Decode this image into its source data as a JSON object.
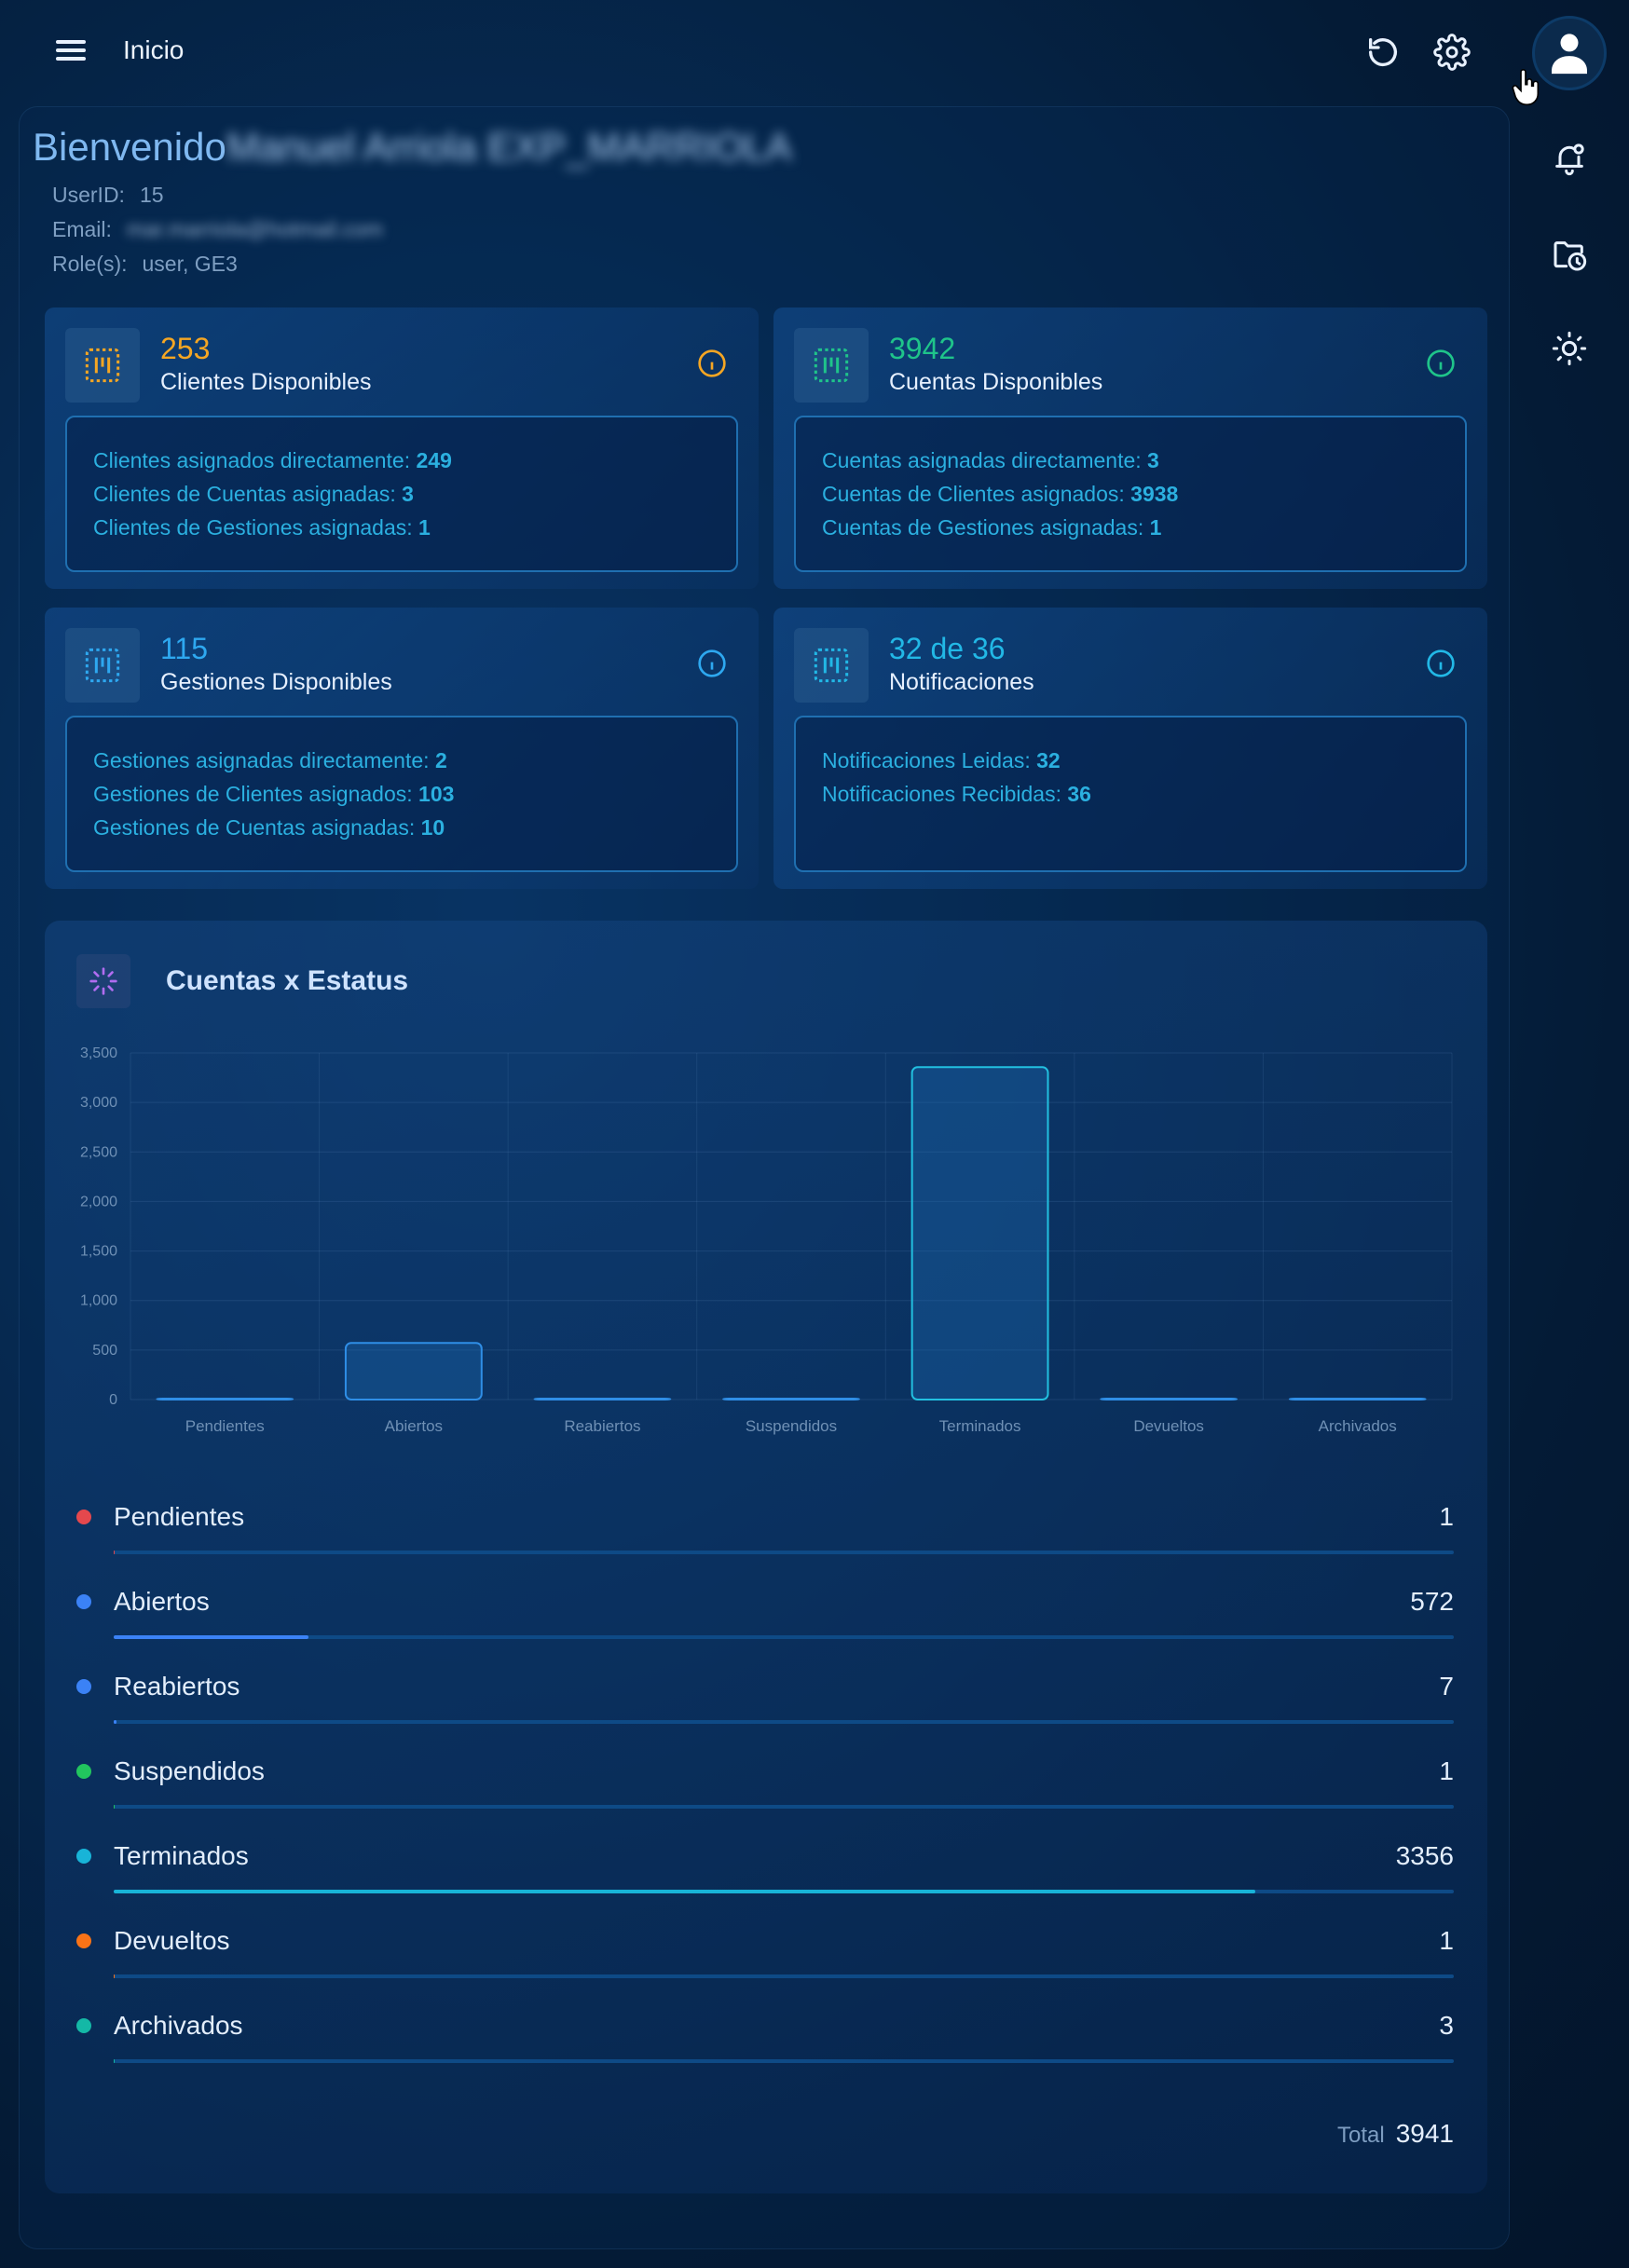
{
  "header": {
    "title": "Inicio",
    "icons": [
      "menu-icon",
      "refresh-icon",
      "gear-icon",
      "user-avatar-icon"
    ]
  },
  "rail": {
    "icons": [
      "bell-icon",
      "folder-clock-icon",
      "sun-icon"
    ]
  },
  "welcome": {
    "greeting": "Bienvenido",
    "name": "Manuel Arriola EXP_MARRIOLA",
    "user_id_label": "UserID:",
    "user_id": "15",
    "email_label": "Email:",
    "email": "mar.marriola@hotmail.com",
    "roles_label": "Role(s):",
    "roles": "user, GE3"
  },
  "cards": {
    "clientes": {
      "value": "253",
      "label": "Clientes Disponibles",
      "accent": "#f5a623",
      "lines": [
        {
          "text": "Clientes asignados directamente: ",
          "val": "249"
        },
        {
          "text": "Clientes de Cuentas asignadas: ",
          "val": "3"
        },
        {
          "text": "Clientes de Gestiones asignadas: ",
          "val": "1"
        }
      ]
    },
    "cuentas": {
      "value": "3942",
      "label": "Cuentas Disponibles",
      "accent": "#1fc48a",
      "lines": [
        {
          "text": "Cuentas asignadas directamente: ",
          "val": "3"
        },
        {
          "text": "Cuentas de Clientes asignados: ",
          "val": "3938"
        },
        {
          "text": "Cuentas de Gestiones asignadas: ",
          "val": "1"
        }
      ]
    },
    "gestiones": {
      "value": "115",
      "label": "Gestiones Disponibles",
      "accent": "#2ea8f0",
      "lines": [
        {
          "text": "Gestiones asignadas directamente: ",
          "val": "2"
        },
        {
          "text": "Gestiones de Clientes asignados: ",
          "val": "103"
        },
        {
          "text": "Gestiones de Cuentas asignadas: ",
          "val": "10"
        }
      ]
    },
    "notificaciones": {
      "value": "32 de 36",
      "label": "Notificaciones",
      "accent": "#22b8e6",
      "lines": [
        {
          "text": "Notificaciones Leidas: ",
          "val": "32"
        },
        {
          "text": "Notificaciones Recibidas: ",
          "val": "36"
        }
      ]
    }
  },
  "chart_title": "Cuentas x Estatus",
  "chart_data": {
    "type": "bar",
    "title": "Cuentas x Estatus",
    "categories": [
      "Pendientes",
      "Abiertos",
      "Reabiertos",
      "Suspendidos",
      "Terminados",
      "Devueltos",
      "Archivados"
    ],
    "values": [
      1,
      572,
      7,
      1,
      3356,
      1,
      3
    ],
    "ylim": [
      0,
      3500
    ],
    "yticks": [
      "0",
      "500",
      "1,000",
      "1,500",
      "2,000",
      "2,500",
      "3,000",
      "3,500"
    ],
    "grid": true
  },
  "legend": [
    {
      "label": "Pendientes",
      "value": "1",
      "color": "#e5484d"
    },
    {
      "label": "Abiertos",
      "value": "572",
      "color": "#3b82f6"
    },
    {
      "label": "Reabiertos",
      "value": "7",
      "color": "#3b82f6"
    },
    {
      "label": "Suspendidos",
      "value": "1",
      "color": "#22c55e"
    },
    {
      "label": "Terminados",
      "value": "3356",
      "color": "#18b4d8"
    },
    {
      "label": "Devueltos",
      "value": "1",
      "color": "#f97316"
    },
    {
      "label": "Archivados",
      "value": "3",
      "color": "#14b8a6"
    }
  ],
  "total": {
    "label": "Total",
    "value": "3941"
  }
}
